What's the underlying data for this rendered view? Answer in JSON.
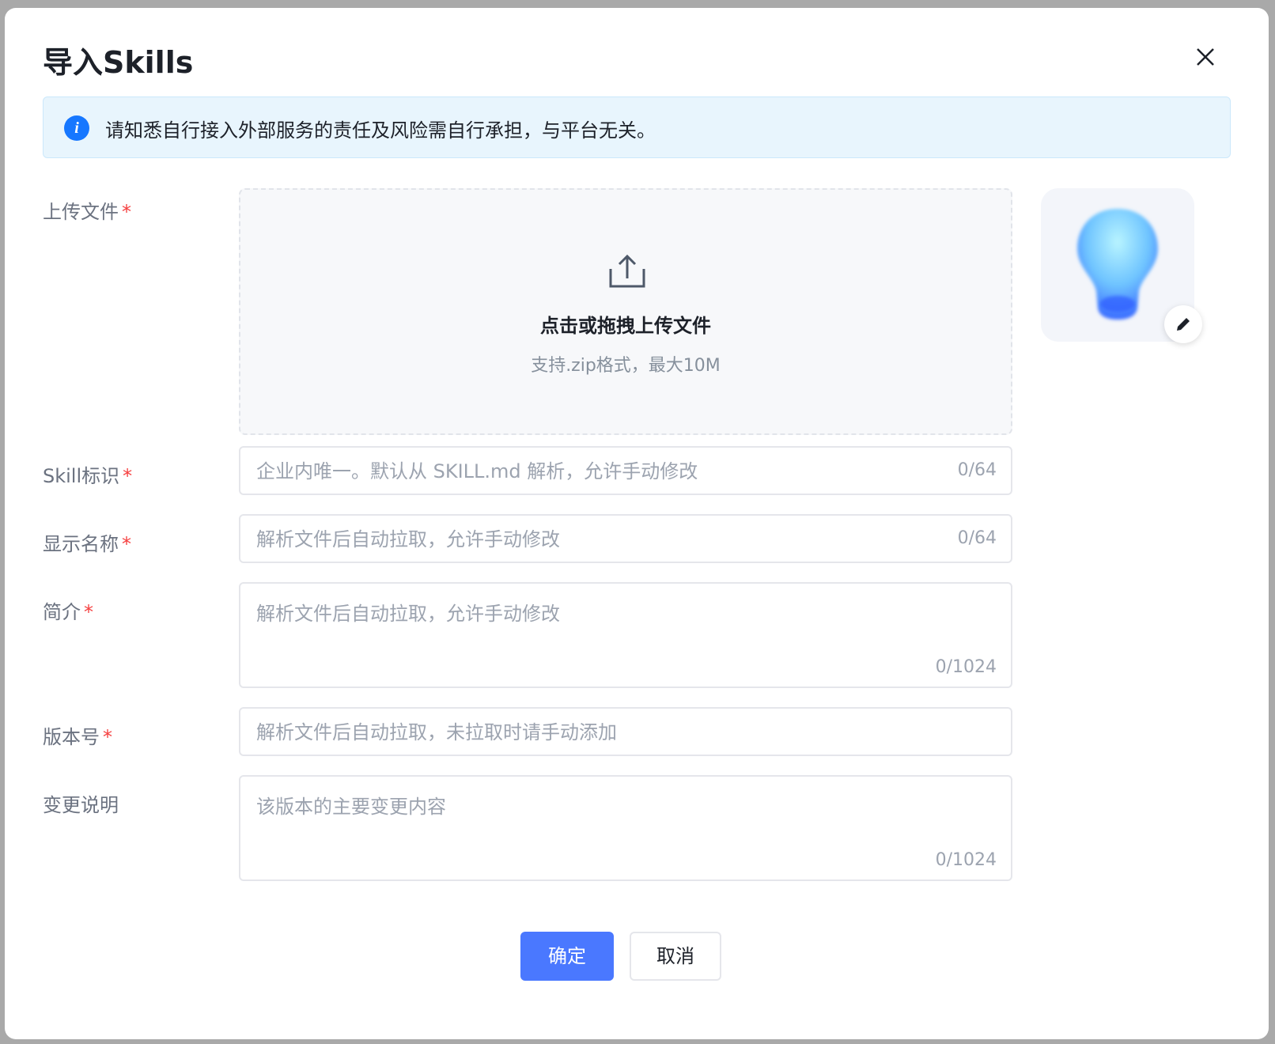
{
  "dialog": {
    "title": "导入Skills",
    "notice": "请知悉自行接入外部服务的责任及风险需自行承担，与平台无关。"
  },
  "upload": {
    "label": "上传文件",
    "main_text": "点击或拖拽上传文件",
    "sub_text": "支持.zip格式，最大10M"
  },
  "fields": {
    "skill_id": {
      "label": "Skill标识",
      "placeholder": "企业内唯一。默认从 SKILL.md 解析，允许手动修改",
      "count": "0/64"
    },
    "display_name": {
      "label": "显示名称",
      "placeholder": "解析文件后自动拉取，允许手动修改",
      "count": "0/64"
    },
    "intro": {
      "label": "简介",
      "placeholder": "解析文件后自动拉取，允许手动修改",
      "count": "0/1024"
    },
    "version": {
      "label": "版本号",
      "placeholder": "解析文件后自动拉取，未拉取时请手动添加"
    },
    "changelog": {
      "label": "变更说明",
      "placeholder": "该版本的主要变更内容",
      "count": "0/1024"
    }
  },
  "required_mark": "*",
  "buttons": {
    "ok": "确定",
    "cancel": "取消"
  },
  "colors": {
    "primary": "#4a78ff",
    "required": "#f53f3f",
    "info": "#1677ff",
    "notice_bg": "#e8f5fd"
  },
  "icons": {
    "close": "close-icon",
    "info": "info-icon",
    "upload": "upload-icon",
    "edit": "pencil-icon",
    "avatar": "lightbulb-icon"
  }
}
